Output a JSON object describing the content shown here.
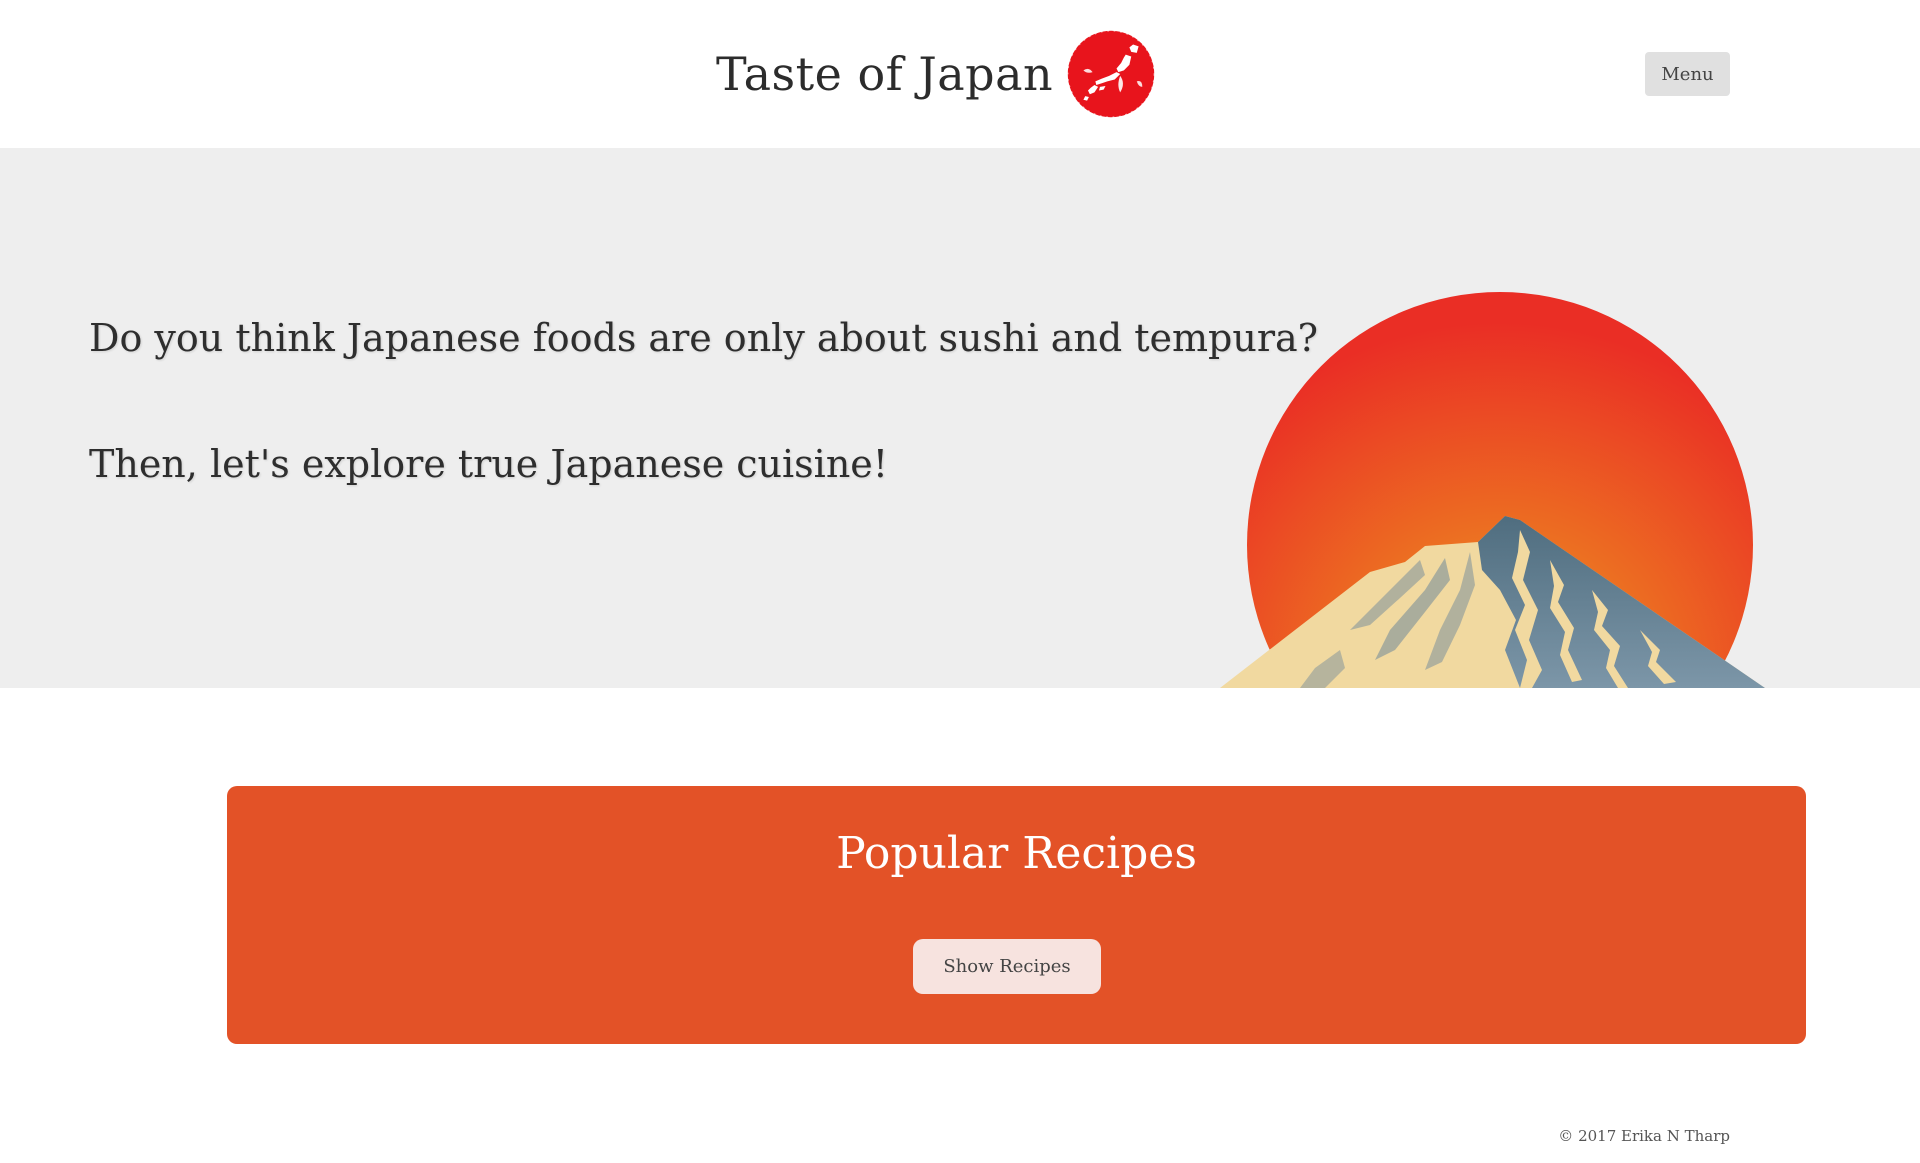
{
  "header": {
    "title": "Taste of Japan",
    "logo_icon": "japan-map-rising-sun-icon",
    "menu_label": "Menu"
  },
  "hero": {
    "line1": "Do you think Japanese foods are only about sushi and tempura?",
    "line2": "Then, let's explore true Japanese cuisine!",
    "illustration": "mount-fuji-rising-sun"
  },
  "recipes": {
    "title": "Popular Recipes",
    "button_label": "Show Recipes"
  },
  "footer": {
    "copyright": "© 2017 Erika N Tharp"
  },
  "colors": {
    "accent": "#e35227",
    "logo_red": "#e8141c",
    "hero_bg": "#eeeeee",
    "menu_bg": "#e0e0e0",
    "button_bg": "#f7e3df"
  }
}
